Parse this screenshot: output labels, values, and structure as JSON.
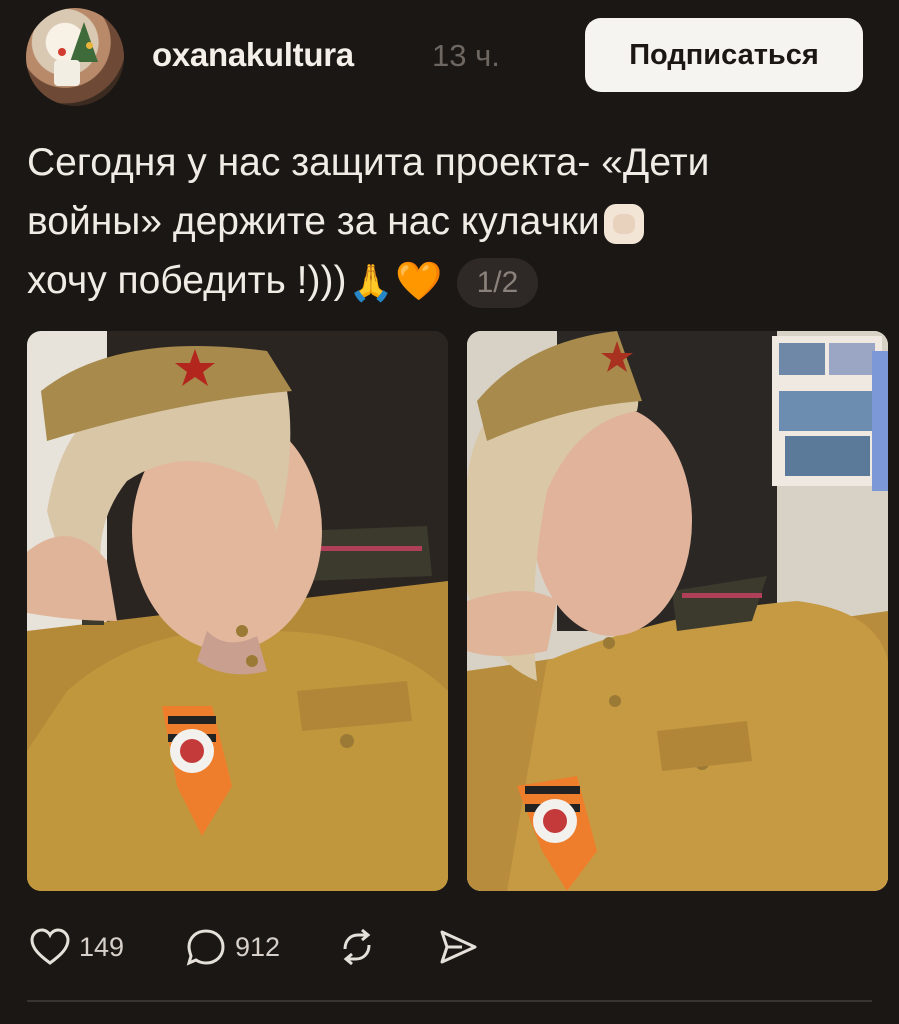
{
  "post": {
    "username": "oxanakultura",
    "time": "13 ч.",
    "subscribe_label": "Подписаться",
    "text_line1": "Сегодня у нас защита проекта- «Дети",
    "text_line2": "войны» держите за нас кулачки",
    "text_line3": "хочу победить !)))",
    "emoji_fist": "fist-emoji",
    "emoji_pray": "🙏",
    "emoji_heart": "🧡",
    "pager": "1/2"
  },
  "photos": [
    {
      "icon": "photo-uniform-selfie-1"
    },
    {
      "icon": "photo-uniform-selfie-2"
    }
  ],
  "actions": {
    "likes": "149",
    "comments": "912",
    "like_icon": "heart-icon",
    "comment_icon": "comment-icon",
    "repost_icon": "repost-icon",
    "share_icon": "share-icon"
  },
  "colors": {
    "background": "#1b1714",
    "subscribe_bg": "#f6f4f1",
    "heart_emoji": "#ff6a1f",
    "muted": "#6e6660"
  }
}
